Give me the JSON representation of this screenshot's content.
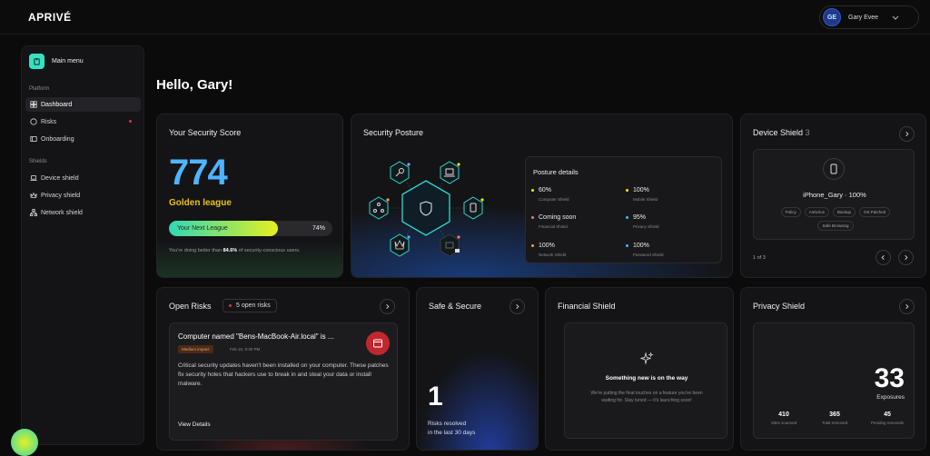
{
  "app": {
    "logo": "APRIVÉ"
  },
  "user": {
    "initials": "GE",
    "name": "Gary Evee"
  },
  "sidebar": {
    "main_menu": "Main menu",
    "platform_label": "Platform",
    "shields_label": "Shields",
    "platform_items": [
      {
        "label": "Dashboard"
      },
      {
        "label": "Risks"
      },
      {
        "label": "Onboarding"
      }
    ],
    "shield_items": [
      {
        "label": "Device shield"
      },
      {
        "label": "Privacy shield"
      },
      {
        "label": "Network shield"
      }
    ]
  },
  "greeting": "Hello, Gary!",
  "score": {
    "title": "Your Security Score",
    "value": "774",
    "league": "Golden league",
    "bar_label": "Your Next League",
    "bar_value": "74%",
    "bar_fraction": 0.74,
    "note_pre": "You're doing better than ",
    "note_bold": "84.6%",
    "note_post": " of security-conscious users."
  },
  "posture": {
    "title": "Security Posture",
    "details_title": "Posture details",
    "items": [
      {
        "value": "60%",
        "label": "Computer Shield",
        "color": "#e6f01e"
      },
      {
        "value": "100%",
        "label": "Mobile Shield",
        "color": "#e6f01e"
      },
      {
        "value": "Coming soon",
        "label": "Financial Shield",
        "color": "#f07a7a"
      },
      {
        "value": "95%",
        "label": "Privacy Shield",
        "color": "#4fb3ff"
      },
      {
        "value": "100%",
        "label": "Network Shield",
        "color": "#f0a050"
      },
      {
        "value": "100%",
        "label": "Password Shield",
        "color": "#4fb3ff"
      }
    ]
  },
  "device": {
    "title": "Device Shield",
    "count": "3",
    "device_name": "iPhone_Gary",
    "device_score": "100%",
    "chips": [
      "Policy",
      "Antivirus",
      "Backup",
      "OS Patched",
      "Safe Browsing"
    ],
    "pager": "1 of 3"
  },
  "risks": {
    "title": "Open Risks",
    "count_label": "5 open risks",
    "item_title": "Computer named \"Bens-MacBook-Air.local\" is ...",
    "badge": "Medium impact",
    "date": "Feb 15, 9:30 PM",
    "description": "Critical security updates haven't been installed on your computer. These patches fix security holes that hackers use to break in and steal your data or install malware.",
    "link": "View Details"
  },
  "safe": {
    "title": "Safe & Secure",
    "value": "1",
    "caption_line1": "Risks resolved",
    "caption_line2": "in the last 30 days"
  },
  "financial": {
    "title": "Financial Shield",
    "heading": "Something new is on the way",
    "text": "We're putting the final touches on a feature you've been waiting for. Stay tuned — it's launching soon!"
  },
  "privacy": {
    "title": "Privacy Shield",
    "value": "33",
    "value_label": "Exposures",
    "stats": [
      {
        "value": "410",
        "label": "Sites scanned"
      },
      {
        "value": "365",
        "label": "Total removed"
      },
      {
        "value": "45",
        "label": "Pending removals"
      }
    ]
  }
}
